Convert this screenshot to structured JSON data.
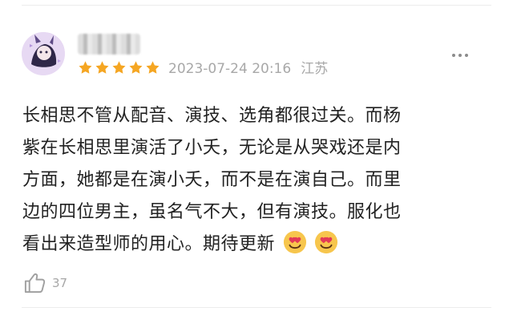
{
  "comment": {
    "rating": 5,
    "timestamp": "2023-07-24 20:16",
    "location": "江苏",
    "content_lines": [
      "长相思不管从配音、演技、选角都很过关。而杨",
      "紫在长相思里演活了小夭，无论是从哭戏还是内",
      "方面，她都是在演小夭，而不是在演自己。而里",
      "边的四位男主，虽名气不大，但有演技。服化也",
      "看出来造型师的用心。期待更新"
    ],
    "like_count": "37"
  },
  "icons": {
    "avatar": "avatar-icon",
    "more": "more-dots-icon",
    "star": "star-icon",
    "emoji": "heart-eyes-emoji-icon",
    "like": "thumbs-up-icon"
  },
  "colors": {
    "star": "#f5a623",
    "meta_text": "#a8a8a8",
    "body_text": "#222222",
    "like_count": "#a7a7a7"
  }
}
